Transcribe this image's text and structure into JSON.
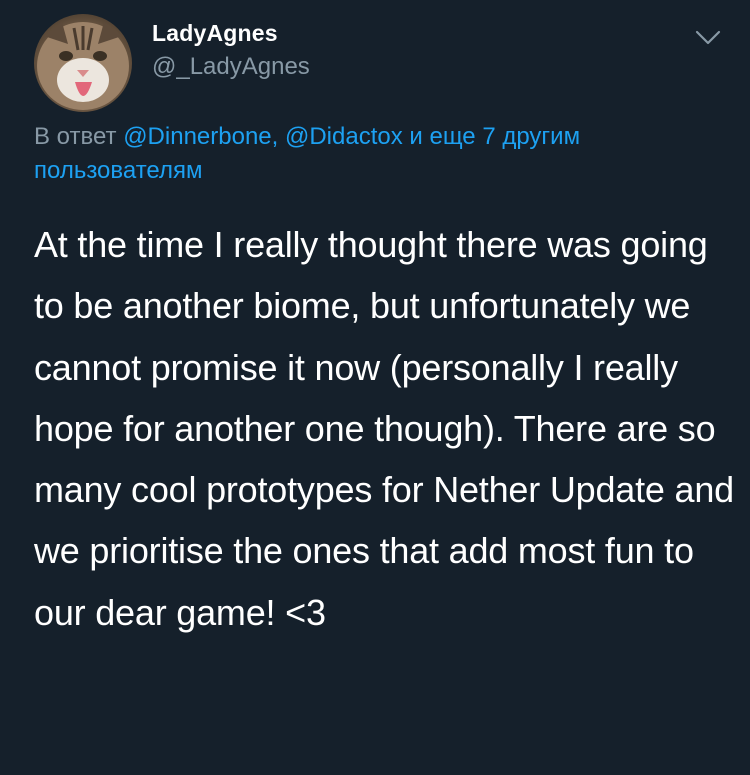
{
  "user": {
    "display_name": "LadyAgnes",
    "handle": "@_LadyAgnes",
    "avatar_icon": "cat-avatar"
  },
  "reply": {
    "prefix": "В ответ",
    "mention_1": "@Dinnerbone,",
    "mention_2": "@Didactox",
    "conjunction": "и",
    "others": "еще 7 другим пользователям"
  },
  "tweet": {
    "text": "At the time I really thought there was going to be another biome, but unfortunately we cannot promise it now (personally I really hope for another one though). There are so many cool prototypes for Nether Update and we prioritise the ones that add most fun to our dear game! <3"
  },
  "menu": {
    "icon": "chevron-down-icon"
  },
  "colors": {
    "background": "#15202b",
    "text": "#ffffff",
    "secondary": "#8899a6",
    "link": "#1da1f2"
  }
}
